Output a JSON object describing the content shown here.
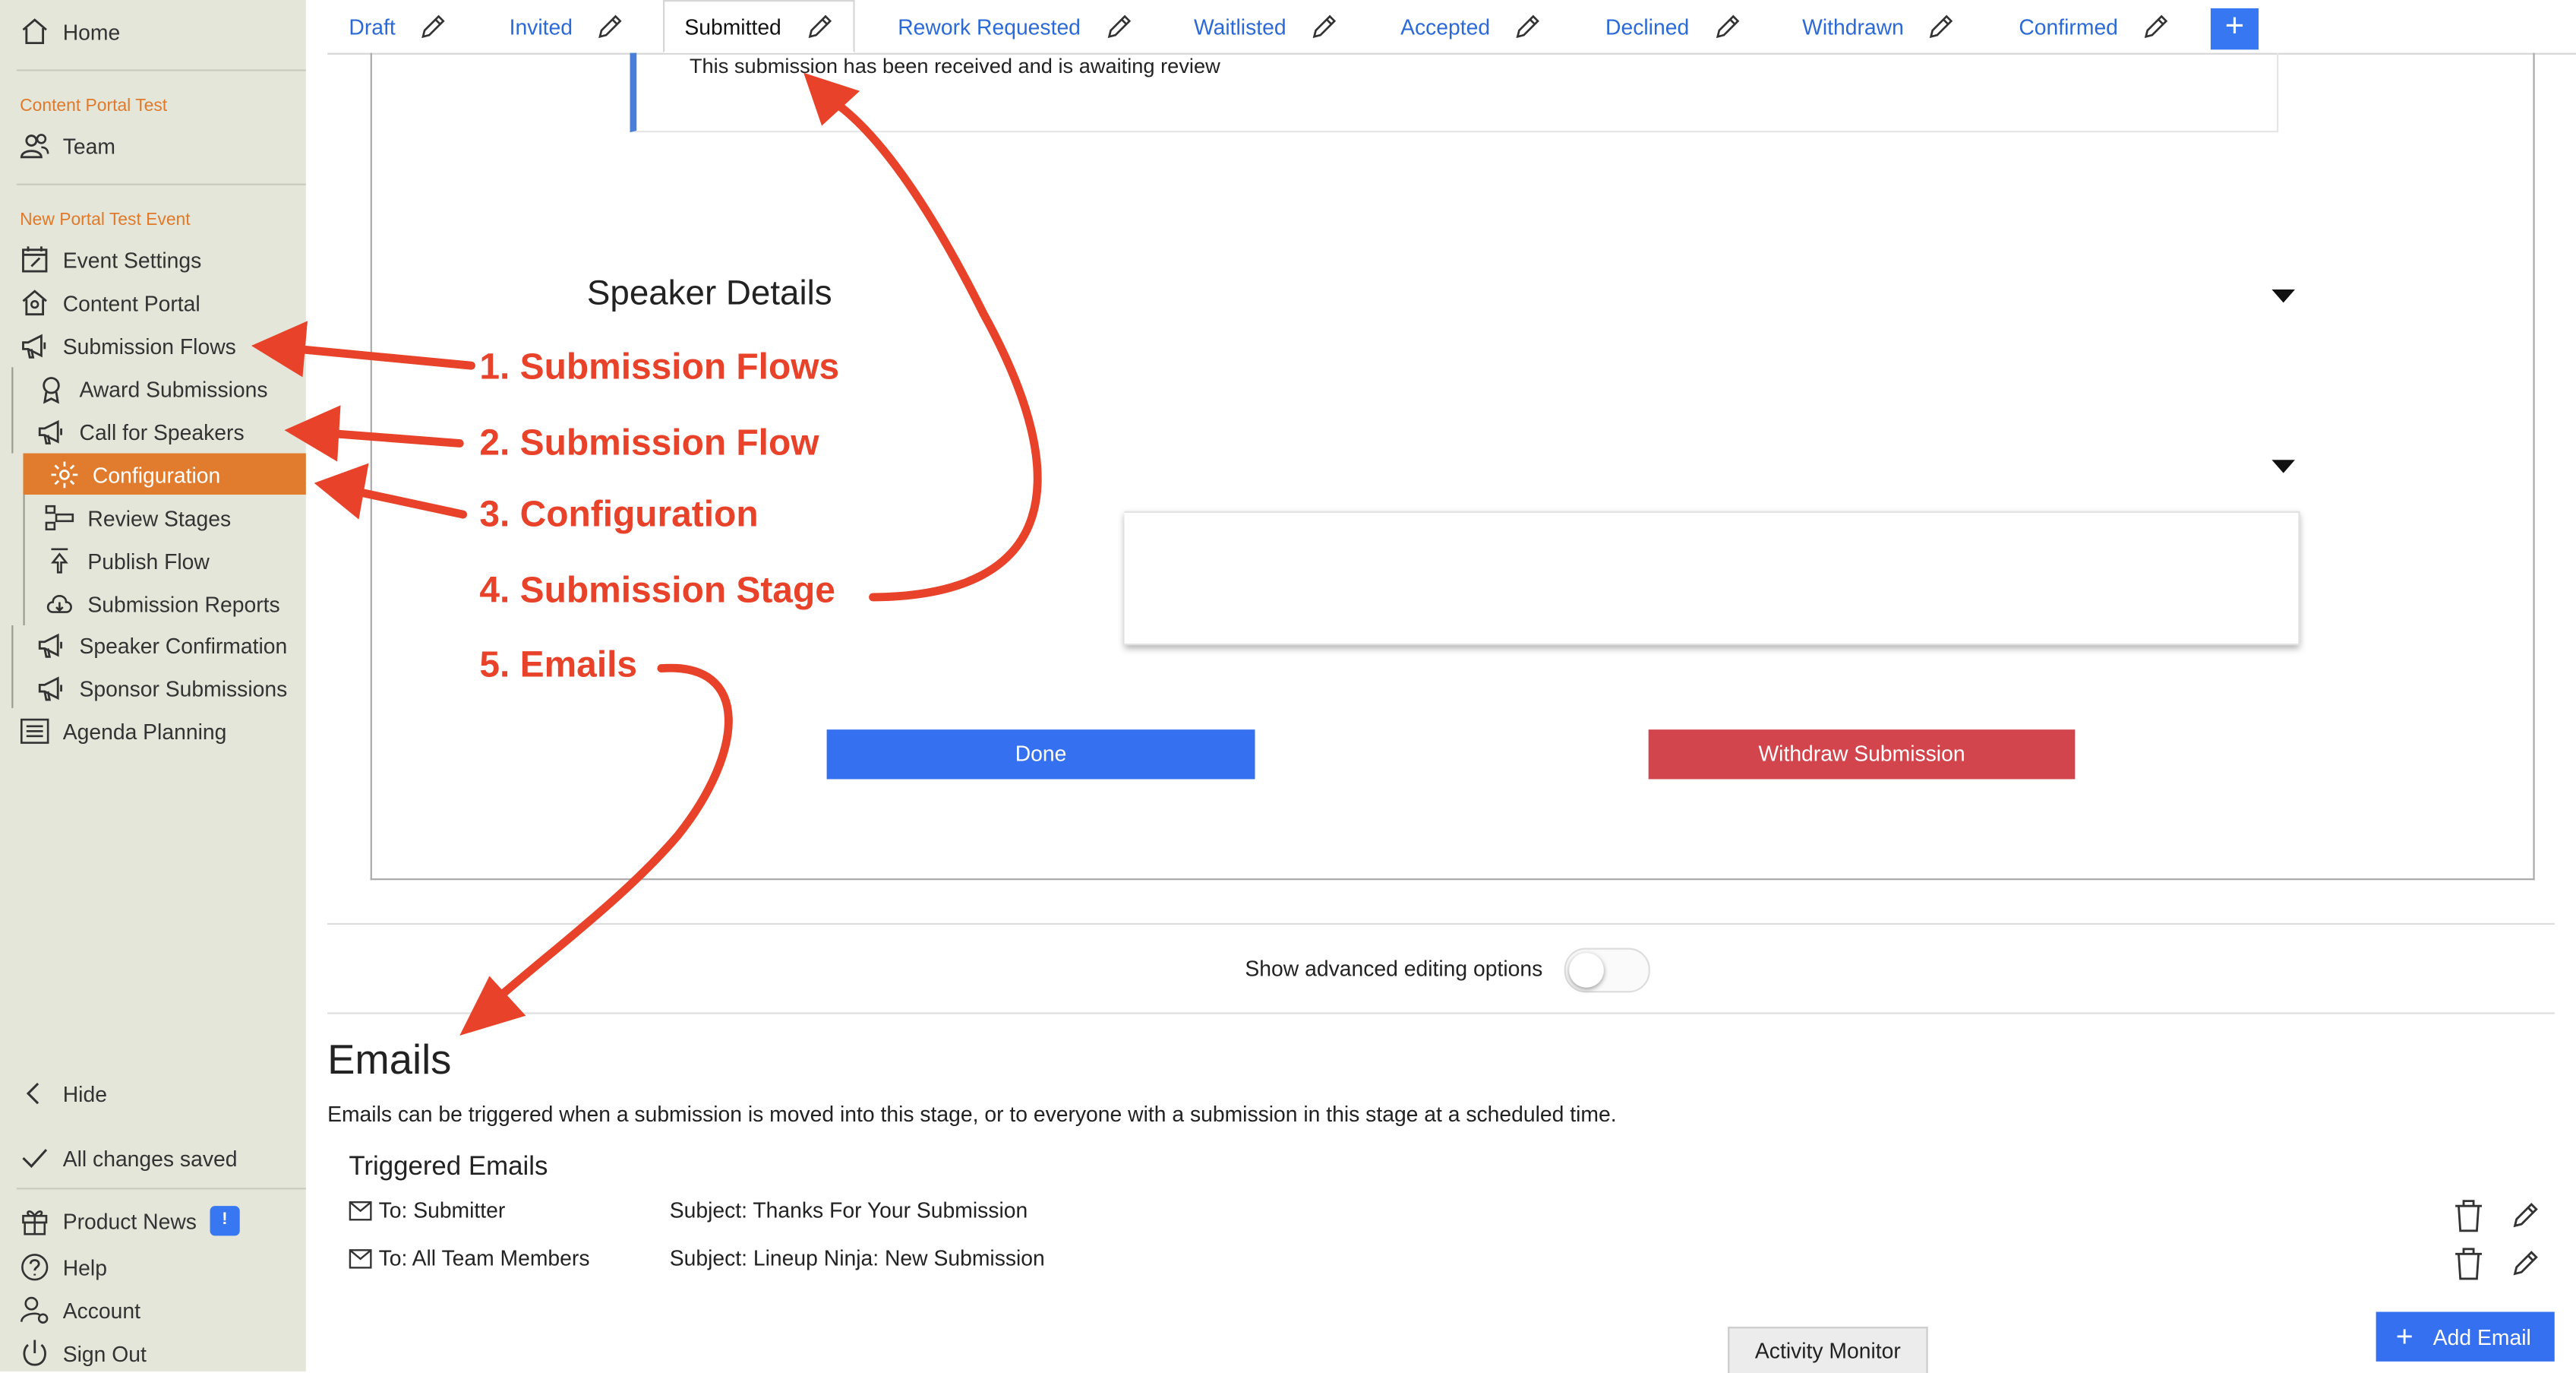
{
  "sidebar": {
    "home": "Home",
    "section1": "Content Portal Test",
    "team": "Team",
    "section2": "New Portal Test Event",
    "items": [
      {
        "label": "Event Settings"
      },
      {
        "label": "Content Portal"
      },
      {
        "label": "Submission Flows"
      },
      {
        "label": "Award Submissions"
      },
      {
        "label": "Call for Speakers"
      },
      {
        "label": "Configuration"
      },
      {
        "label": "Review Stages"
      },
      {
        "label": "Publish Flow"
      },
      {
        "label": "Submission Reports"
      },
      {
        "label": "Speaker Confirmation"
      },
      {
        "label": "Sponsor Submissions"
      },
      {
        "label": "Agenda Planning"
      }
    ],
    "hide": "Hide",
    "saved": "All changes saved",
    "product_news": "Product News",
    "news_badge": "!",
    "help": "Help",
    "account": "Account",
    "sign_out": "Sign Out"
  },
  "tabs": [
    {
      "label": "Draft"
    },
    {
      "label": "Invited"
    },
    {
      "label": "Submitted"
    },
    {
      "label": "Rework Requested"
    },
    {
      "label": "Waitlisted"
    },
    {
      "label": "Accepted"
    },
    {
      "label": "Declined"
    },
    {
      "label": "Withdrawn"
    },
    {
      "label": "Confirmed"
    }
  ],
  "tab_add": "+",
  "main": {
    "message": "This submission has been received and is awaiting review",
    "speaker_details": "Speaker Details",
    "done": "Done",
    "withdraw": "Withdraw Submission",
    "advanced": "Show advanced editing options"
  },
  "emails": {
    "title": "Emails",
    "description": "Emails can be triggered when a submission is moved into this stage, or to everyone with a submission in this stage at a scheduled time.",
    "triggered_title": "Triggered Emails",
    "rows": [
      {
        "to": "To: Submitter",
        "subject": "Subject: Thanks For Your Submission"
      },
      {
        "to": "To: All Team Members",
        "subject": "Subject: Lineup Ninja: New Submission"
      }
    ],
    "add": "Add Email"
  },
  "activity_monitor": "Activity Monitor",
  "annotations": [
    "1. Submission Flows",
    "2. Submission Flow",
    "3. Configuration",
    "4. Submission Stage",
    "5. Emails"
  ],
  "colors": {
    "accent_orange": "#e17c2e",
    "primary_blue": "#3570f0",
    "danger_red": "#d2454d",
    "annotation_red": "#e8432a",
    "sidebar_bg": "#e4e6da"
  }
}
